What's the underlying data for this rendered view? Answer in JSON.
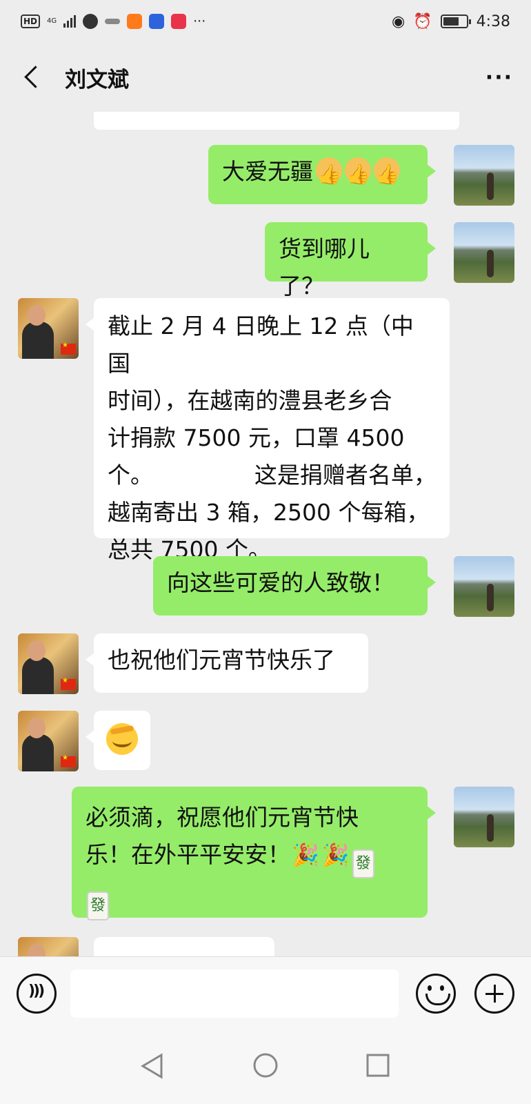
{
  "status_bar": {
    "hd": "HD",
    "network": "4G",
    "more": "···",
    "time": "4:38"
  },
  "header": {
    "title": "刘文斌",
    "more": "···"
  },
  "messages": [
    {
      "side": "me",
      "text": "大爱无疆"
    },
    {
      "side": "me",
      "text": "货到哪儿了？"
    },
    {
      "side": "them",
      "lines": [
        "截止 2 月 4 日晚上 12 点（中国",
        "时间），在越南的澧县老乡合",
        "计捐款 7500 元，口罩 4500",
        "个。              这是捐赠者名单，",
        "越南寄出 3 箱，2500 个每箱，",
        "总共 7500 个。"
      ]
    },
    {
      "side": "me",
      "text": "向这些可爱的人致敬！"
    },
    {
      "side": "them",
      "text": "也祝他们元宵节快乐了"
    },
    {
      "side": "them",
      "emoji": "facepalm"
    },
    {
      "side": "me",
      "lines": [
        "必须滴，祝愿他们元宵节快",
        "乐！在外平平安安！"
      ]
    }
  ],
  "tiles": {
    "fa": "發"
  },
  "input": {
    "placeholder": ""
  }
}
